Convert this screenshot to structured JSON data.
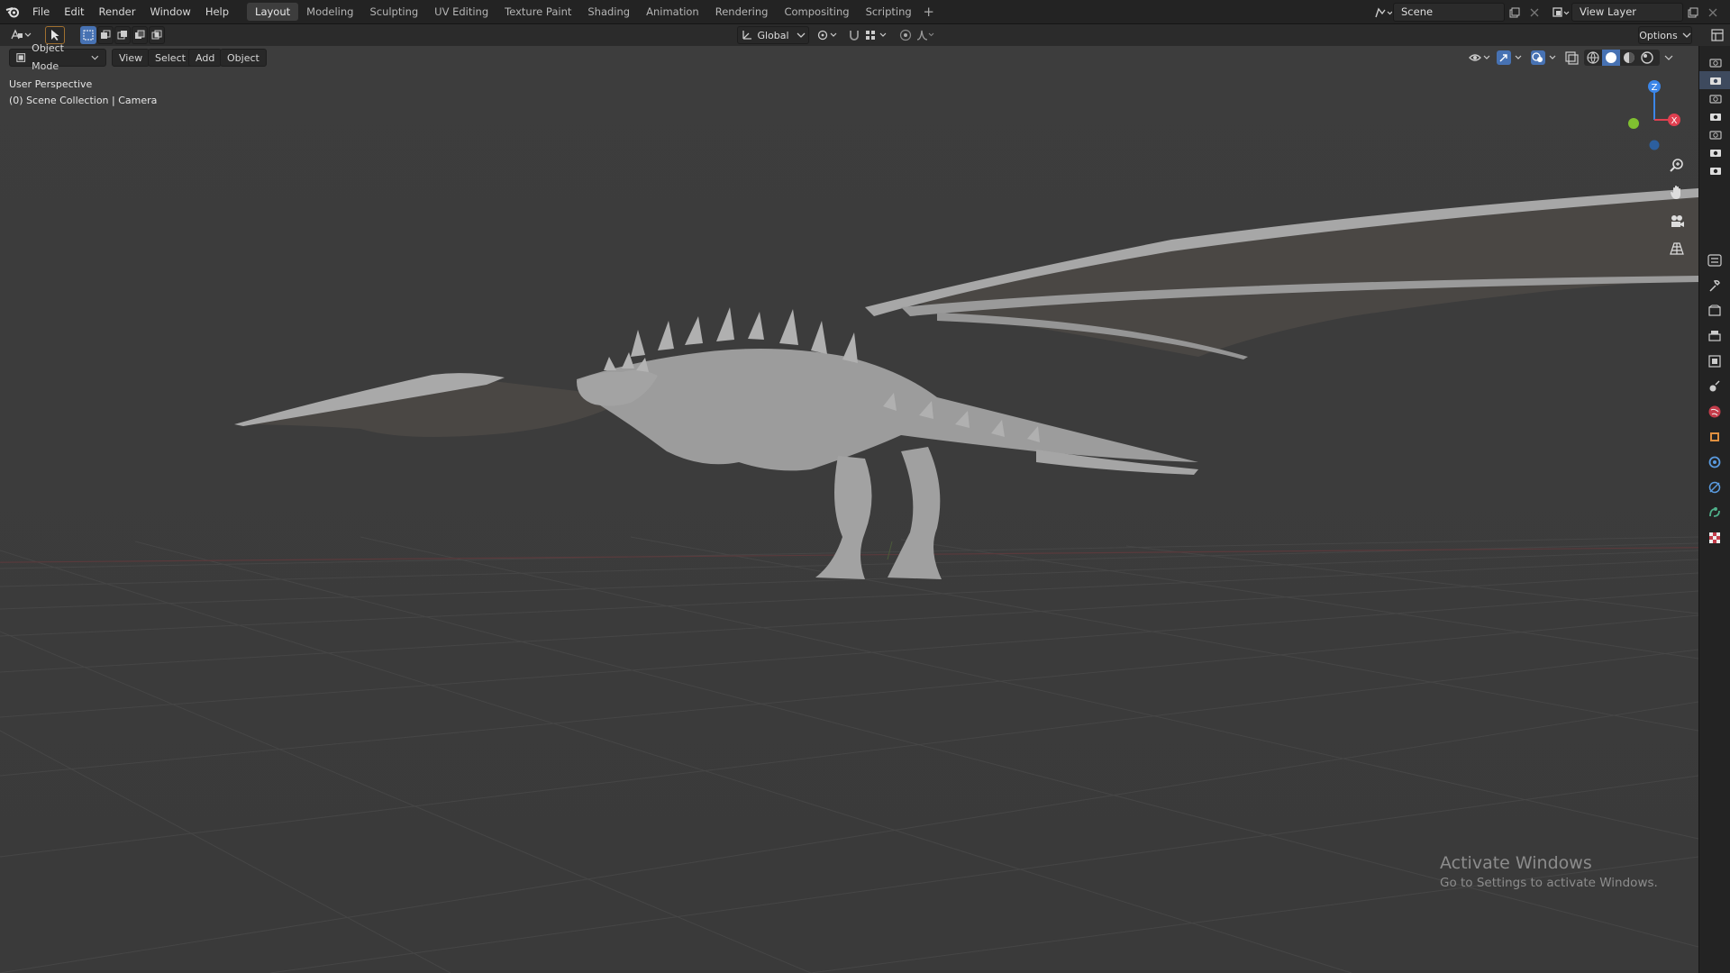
{
  "menu": [
    "File",
    "Edit",
    "Render",
    "Window",
    "Help"
  ],
  "workspaces": [
    "Layout",
    "Modeling",
    "Sculpting",
    "UV Editing",
    "Texture Paint",
    "Shading",
    "Animation",
    "Rendering",
    "Compositing",
    "Scripting"
  ],
  "active_workspace": "Layout",
  "scene": {
    "name": "Scene"
  },
  "view_layer": {
    "name": "View Layer"
  },
  "toolbar": {
    "orientation": "Global",
    "options_label": "Options"
  },
  "viewport_header": {
    "mode": "Object Mode",
    "menus": [
      "View",
      "Select",
      "Add",
      "Object"
    ]
  },
  "overlay": {
    "perspective": "User Perspective",
    "collection": "(0) Scene Collection | Camera"
  },
  "gizmo": {
    "z": "Z",
    "x": "X"
  },
  "watermark": {
    "title": "Activate Windows",
    "subtitle": "Go to Settings to activate Windows."
  },
  "colors": {
    "accent": "#4772b3",
    "axis_x": "#e04050",
    "axis_y": "#80c030",
    "axis_z": "#3b86e8"
  }
}
